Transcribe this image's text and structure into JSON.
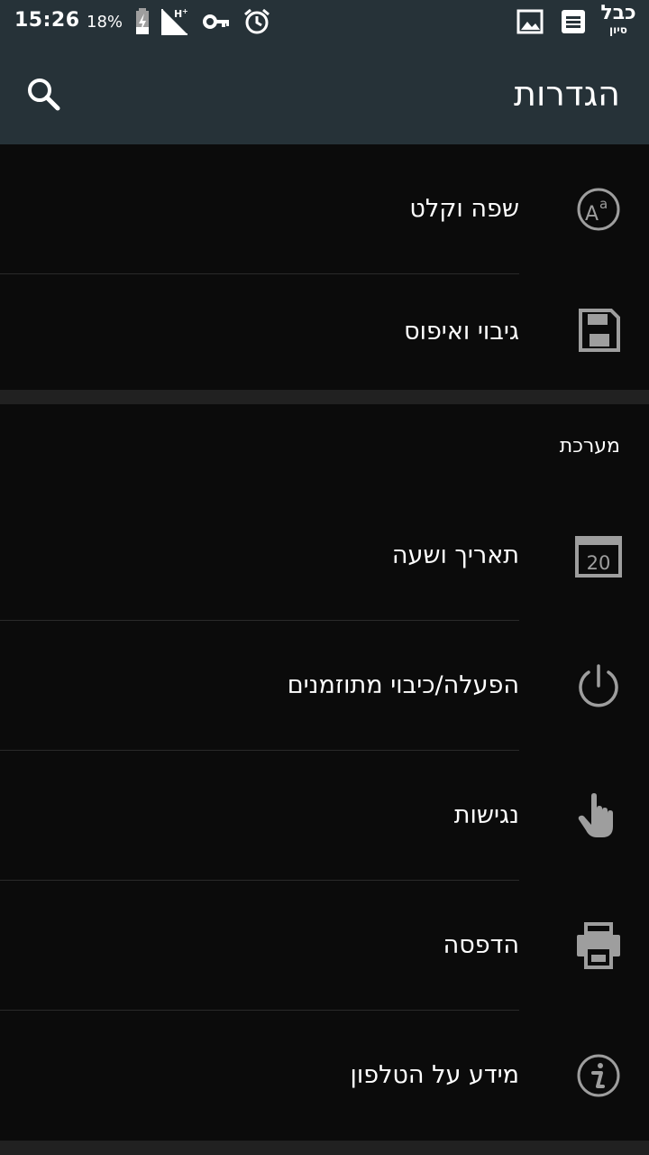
{
  "status_bar": {
    "time": "15:26",
    "battery_percent": "18%",
    "carrier_line1": "כבל",
    "carrier_line2": "סיון",
    "icons": [
      "battery-charging-icon",
      "signal-hplus-icon",
      "vpn-key-icon",
      "alarm-icon",
      "image-icon",
      "notes-icon"
    ]
  },
  "app_bar": {
    "title": "הגדרות",
    "search_icon": "search-icon"
  },
  "sections": [
    {
      "header": "",
      "items": [
        {
          "label": "שפה וקלט",
          "icon": "language-icon"
        },
        {
          "label": "גיבוי ואיפוס",
          "icon": "save-icon"
        }
      ]
    },
    {
      "header": "מערכת",
      "items": [
        {
          "label": "תאריך ושעה",
          "icon": "calendar-icon",
          "icon_text": "20"
        },
        {
          "label": "הפעלה/כיבוי מתוזמנים",
          "icon": "power-icon"
        },
        {
          "label": "נגישות",
          "icon": "hand-pointer-icon"
        },
        {
          "label": "הדפסה",
          "icon": "print-icon"
        },
        {
          "label": "מידע על הטלפון",
          "icon": "info-icon"
        }
      ]
    }
  ],
  "colors": {
    "app_bar": "#263238",
    "background": "#0b0b0b",
    "icon_gray": "#9e9e9e",
    "divider": "#2a2a2a"
  }
}
